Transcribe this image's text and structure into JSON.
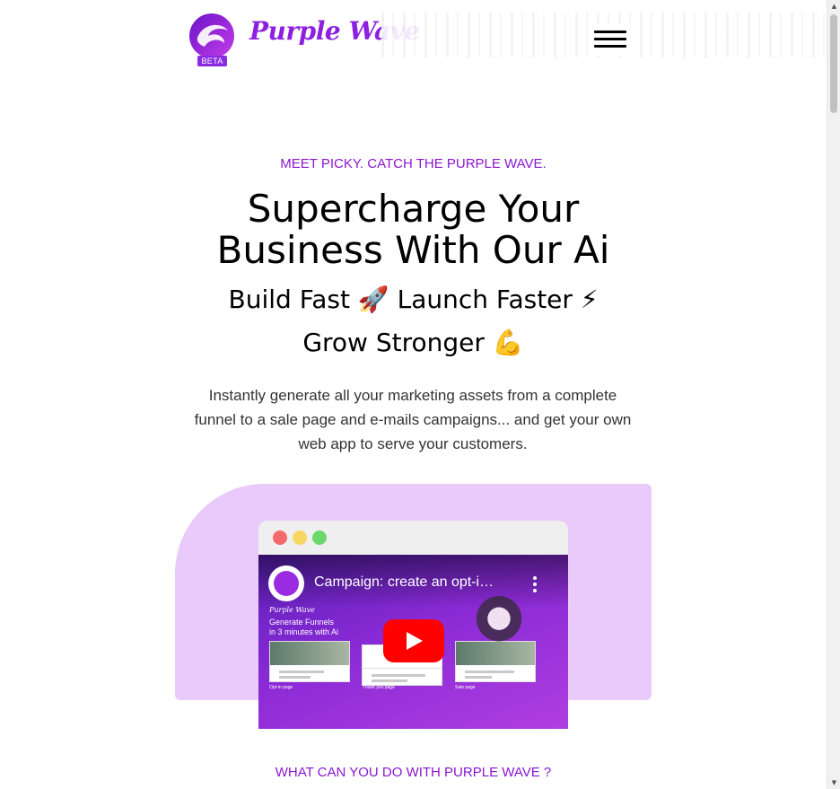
{
  "header": {
    "brand_name": "Purple Wave",
    "beta_label": "BETA",
    "logo_icon": "wave-logo-icon",
    "menu_icon": "hamburger-menu-icon"
  },
  "hero": {
    "eyebrow": "MEET PICKY. CATCH THE PURPLE WAVE.",
    "headline_line1": "Supercharge Your",
    "headline_line2": "Business With Our Ai",
    "subhead_line1": "Build Fast 🚀 Launch Faster ⚡",
    "subhead_line2": "Grow Stronger 💪",
    "description": "Instantly generate all your marketing assets from a complete funnel to a sale page and e-mails campaigns... and get your own web app to serve your customers."
  },
  "video": {
    "title": "Campaign: create an opt-i…",
    "thumbnail_brand": "Purple Wave",
    "thumbnail_heading_line1": "Generate Funnels",
    "thumbnail_heading_line2": "in 3 minutes with Ai",
    "page_labels": [
      "Opt-in page",
      "Thank you page",
      "Sale page"
    ],
    "play_icon": "youtube-play-icon"
  },
  "next_section": {
    "eyebrow": "WHAT CAN YOU DO WITH PURPLE WAVE ?"
  },
  "colors": {
    "brand_purple": "#8a17d0",
    "lilac_panel": "#eac9fb",
    "play_red": "#ff0000"
  }
}
